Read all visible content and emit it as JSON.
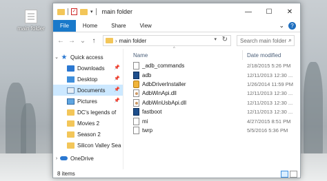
{
  "desktop": {
    "icon_label": "main folder"
  },
  "window": {
    "title": "main folder",
    "controls": {
      "minimize": "—",
      "maximize": "☐",
      "close": "✕"
    }
  },
  "ribbon": {
    "tabs": [
      "File",
      "Home",
      "Share",
      "View"
    ],
    "expand_glyph": "⌄",
    "help_glyph": "?"
  },
  "address": {
    "path_separator": "›",
    "path": "main folder",
    "refresh_glyph": "↻",
    "search_placeholder": "Search main folder",
    "search_glyph": "⌕"
  },
  "nav": {
    "back": "←",
    "forward": "→",
    "recent": "⌄",
    "up": "↑"
  },
  "navpane": {
    "items": [
      {
        "label": "Quick access",
        "icon": "star-icon",
        "pinned": false,
        "expand": "⌄"
      },
      {
        "label": "Downloads",
        "icon": "download-icon",
        "pinned": true
      },
      {
        "label": "Desktop",
        "icon": "desktop-icon",
        "pinned": true
      },
      {
        "label": "Documents",
        "icon": "documents-icon",
        "pinned": true
      },
      {
        "label": "Pictures",
        "icon": "pictures-icon",
        "pinned": true
      },
      {
        "label": "DC's legends of",
        "icon": "folder-icon",
        "pinned": false
      },
      {
        "label": "Movies 2",
        "icon": "folder-icon",
        "pinned": false
      },
      {
        "label": "Season 2",
        "icon": "folder-icon",
        "pinned": false
      },
      {
        "label": "Silicon Valley Sea",
        "icon": "folder-icon",
        "pinned": false
      },
      {
        "label": "OneDrive",
        "icon": "onedrive-icon",
        "pinned": false,
        "expand": "›"
      }
    ]
  },
  "columns": {
    "name": "Name",
    "date": "Date modified"
  },
  "files": [
    {
      "name": "_adb_commands",
      "date": "2/18/2015 5:26 PM",
      "icon": "document-icon"
    },
    {
      "name": "adb",
      "date": "12/11/2013 12:30 ...",
      "icon": "executable-icon"
    },
    {
      "name": "AdbDriverInstaller",
      "date": "1/26/2014 11:59 PM",
      "icon": "installer-icon"
    },
    {
      "name": "AdbWinApi.dll",
      "date": "12/11/2013 12:30 ...",
      "icon": "dll-icon"
    },
    {
      "name": "AdbWinUsbApi.dll",
      "date": "12/11/2013 12:30 ...",
      "icon": "dll-icon"
    },
    {
      "name": "fastboot",
      "date": "12/11/2013 12:30 ...",
      "icon": "executable-icon"
    },
    {
      "name": "mi",
      "date": "4/27/2015 8:51 PM",
      "icon": "document-icon"
    },
    {
      "name": "twrp",
      "date": "5/5/2016 5:36 PM",
      "icon": "document-icon"
    }
  ],
  "status": {
    "count_text": "8 items"
  }
}
